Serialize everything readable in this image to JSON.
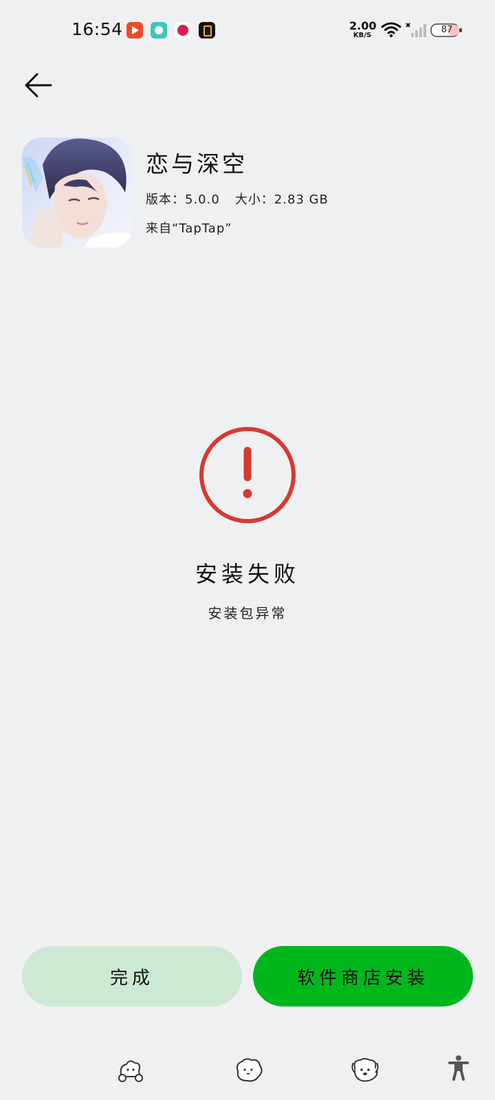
{
  "status_bar": {
    "time": "16:54",
    "net_speed_value": "2.00",
    "net_speed_unit": "KB/S",
    "battery": "87"
  },
  "app": {
    "name": "恋与深空",
    "version_label": "版本：",
    "version": "5.0.0",
    "size_label": "大小：",
    "size": "2.83 GB",
    "source": "来自“TapTap”"
  },
  "install_status": {
    "title": "安装失败",
    "subtitle": "安装包异常"
  },
  "buttons": {
    "done": "完成",
    "store_install": "软件商店安装"
  },
  "colors": {
    "background": "#eff0f2",
    "error_red": "#d63a2f",
    "primary_green": "#00b71b",
    "secondary_green": "#cde9d3"
  }
}
